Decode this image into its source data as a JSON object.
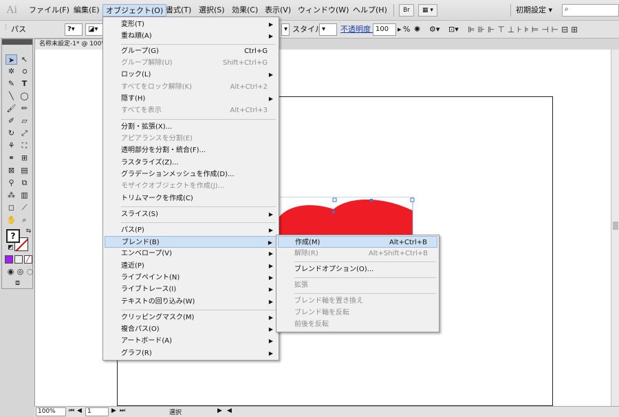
{
  "app": {
    "logo": "Ai"
  },
  "menubar": {
    "items": [
      "ファイル(F)",
      "編集(E)",
      "オブジェクト(O)",
      "書式(T)",
      "選択(S)",
      "効果(C)",
      "表示(V)",
      "ウィンドウ(W)",
      "ヘルプ(H)"
    ],
    "bridge_label": "Br",
    "workspace": "初期設定 ▾",
    "search_icon": "search-icon"
  },
  "controlbar": {
    "path_label": "パス",
    "style_label": "スタイル :",
    "opacity_label": "不透明度 :",
    "opacity_value": "100",
    "opacity_unit": "%"
  },
  "document": {
    "tab_title": "名称未設定-1* @ 100%"
  },
  "statusbar": {
    "zoom": "100%",
    "page": "1",
    "tool": "選択"
  },
  "colors": {
    "heart": "#ee1c25",
    "menu_highlight": "#cfe1f5",
    "anchor": "#3b73d9"
  },
  "object_menu": {
    "items": [
      {
        "label": "変形(T)",
        "submenu": true
      },
      {
        "label": "重ね順(A)",
        "submenu": true
      },
      {
        "label": "グループ(G)",
        "shortcut": "Ctrl+G"
      },
      {
        "label": "グループ解除(U)",
        "shortcut": "Shift+Ctrl+G",
        "disabled": true
      },
      {
        "label": "ロック(L)",
        "submenu": true
      },
      {
        "label": "すべてをロック解除(K)",
        "shortcut": "Alt+Ctrl+2",
        "disabled": true
      },
      {
        "label": "隠す(H)",
        "submenu": true
      },
      {
        "label": "すべてを表示",
        "shortcut": "Alt+Ctrl+3",
        "disabled": true
      },
      {
        "label": "分割・拡張(X)..."
      },
      {
        "label": "アピアランスを分割(E)",
        "disabled": true
      },
      {
        "label": "透明部分を分割・統合(F)..."
      },
      {
        "label": "ラスタライズ(Z)..."
      },
      {
        "label": "グラデーションメッシュを作成(D)..."
      },
      {
        "label": "モザイクオブジェクトを作成(J)...",
        "disabled": true
      },
      {
        "label": "トリムマークを作成(C)"
      },
      {
        "label": "スライス(S)",
        "submenu": true
      },
      {
        "label": "パス(P)",
        "submenu": true
      },
      {
        "label": "ブレンド(B)",
        "submenu": true
      },
      {
        "label": "エンベロープ(V)",
        "submenu": true
      },
      {
        "label": "遠近(P)",
        "submenu": true
      },
      {
        "label": "ライブペイント(N)",
        "submenu": true
      },
      {
        "label": "ライブトレース(I)",
        "submenu": true
      },
      {
        "label": "テキストの回り込み(W)",
        "submenu": true
      },
      {
        "label": "クリッピングマスク(M)",
        "submenu": true
      },
      {
        "label": "複合パス(O)",
        "submenu": true
      },
      {
        "label": "アートボード(A)",
        "submenu": true
      },
      {
        "label": "グラフ(R)",
        "submenu": true
      }
    ]
  },
  "blend_submenu": {
    "items": [
      {
        "label": "作成(M)",
        "shortcut": "Alt+Ctrl+B"
      },
      {
        "label": "解除(R)",
        "shortcut": "Alt+Shift+Ctrl+B",
        "disabled": true
      },
      {
        "label": "ブレンドオプション(O)..."
      },
      {
        "label": "拡張",
        "disabled": true
      },
      {
        "label": "ブレンド軸を置き換え",
        "disabled": true
      },
      {
        "label": "ブレンド軸を反転",
        "disabled": true
      },
      {
        "label": "前後を反転",
        "disabled": true
      }
    ]
  }
}
